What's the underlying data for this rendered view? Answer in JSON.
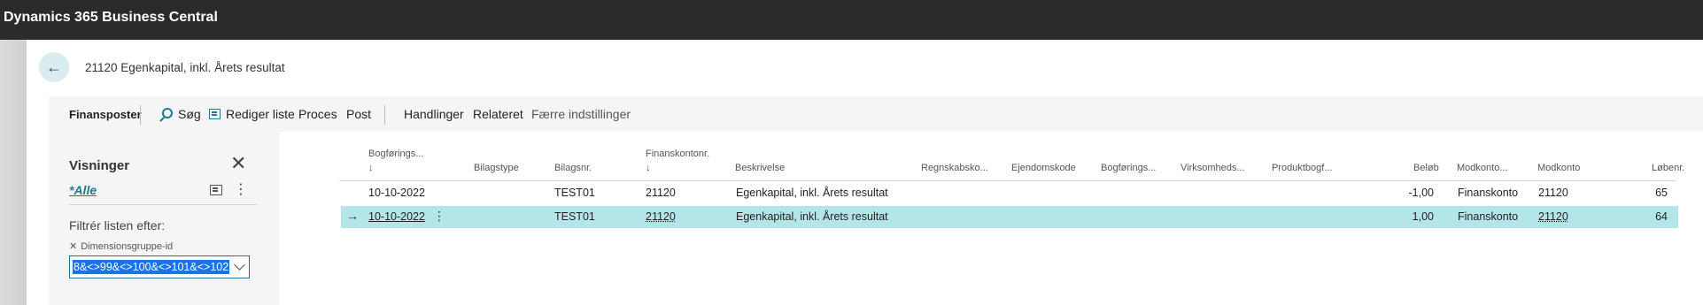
{
  "app": {
    "title": "Dynamics 365 Business Central"
  },
  "page": {
    "title": "21120 Egenkapital, inkl. Årets resultat"
  },
  "actionbar": {
    "page_name": "Finansposter",
    "search": "Søg",
    "edit_list": "Rediger liste",
    "process": "Proces",
    "post": "Post",
    "actions": "Handlinger",
    "related": "Relateret",
    "fewer_options": "Færre indstillinger"
  },
  "filter_pane": {
    "views_title": "Visninger",
    "view_all": "*Alle",
    "filter_label": "Filtrér listen efter:",
    "field_label": "Dimensionsgruppe-id",
    "field_value": "8&<>99&<>100&<>101&<>102"
  },
  "table": {
    "headers": {
      "posting_date": "Bogførings...",
      "doc_type": "Bilagstype",
      "doc_no": "Bilagsnr.",
      "account_no": "Finanskontonr.",
      "description": "Beskrivelse",
      "acc_code": "Regnskabsko...",
      "property_code": "Ejendomskode",
      "posting_group": "Bogførings...",
      "business": "Virksomheds...",
      "product": "Produktbogf...",
      "amount": "Beløb",
      "bal_type": "Modkonto...",
      "bal_account": "Modkonto",
      "entry_no": "Løbenr."
    },
    "sort_arrow": "↓",
    "rows": [
      {
        "posting_date": "10-10-2022",
        "doc_no": "TEST01",
        "account_no": "21120",
        "description": "Egenkapital, inkl. Årets resultat",
        "amount": "-1,00",
        "bal_type": "Finanskonto",
        "bal_account": "21120",
        "entry_no": "65"
      },
      {
        "posting_date": "10-10-2022",
        "doc_no": "TEST01",
        "account_no": "21120",
        "description": "Egenkapital, inkl. Årets resultat",
        "amount": "1,00",
        "bal_type": "Finanskonto",
        "bal_account": "21120",
        "entry_no": "64"
      }
    ]
  },
  "colors": {
    "accent": "#1e7a8c",
    "selected_row": "#b4e6e9",
    "topbar": "#2b2b2b"
  }
}
